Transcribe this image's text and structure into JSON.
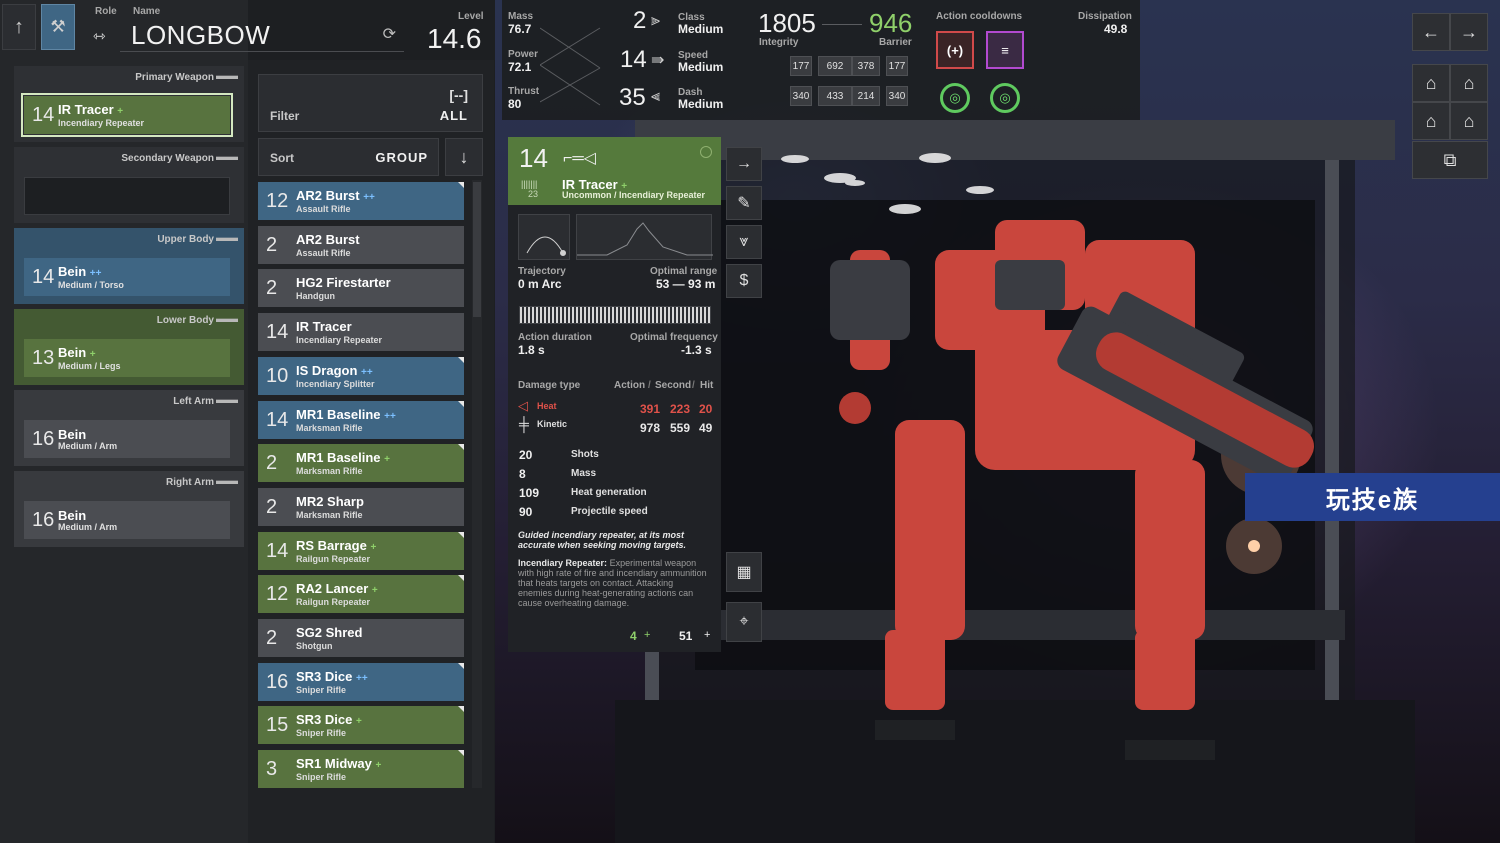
{
  "header": {
    "role_label": "Role",
    "name_label": "Name",
    "name": "LONGBOW",
    "level_label": "Level",
    "level": "14.6"
  },
  "slots": [
    {
      "title": "Primary Weapon",
      "level": "14",
      "name": "IR Tracer",
      "plus": "+",
      "sub": "Incendiary Repeater",
      "color": "green"
    },
    {
      "title": "Secondary Weapon",
      "level": "",
      "name": "",
      "plus": "",
      "sub": "",
      "color": "empty"
    },
    {
      "title": "Upper Body",
      "level": "14",
      "name": "Bein",
      "plus": "++",
      "sub": "Medium / Torso",
      "color": "blue"
    },
    {
      "title": "Lower Body",
      "level": "13",
      "name": "Bein",
      "plus": "+",
      "sub": "Medium / Legs",
      "color": "green"
    },
    {
      "title": "Left Arm",
      "level": "16",
      "name": "Bein",
      "plus": "",
      "sub": "Medium / Arm",
      "color": "grey"
    },
    {
      "title": "Right Arm",
      "level": "16",
      "name": "Bein",
      "plus": "",
      "sub": "Medium / Arm",
      "color": "grey"
    }
  ],
  "filter": {
    "label": "Filter",
    "value": "ALL",
    "icon": "bracket-icon"
  },
  "sort": {
    "label": "Sort",
    "value": "GROUP"
  },
  "items": [
    {
      "level": "12",
      "name": "AR2 Burst",
      "plus": "++",
      "sub": "Assault Rifle",
      "color": "blue"
    },
    {
      "level": "2",
      "name": "AR2 Burst",
      "plus": "",
      "sub": "Assault Rifle",
      "color": "grey"
    },
    {
      "level": "2",
      "name": "HG2 Firestarter",
      "plus": "",
      "sub": "Handgun",
      "color": "grey"
    },
    {
      "level": "14",
      "name": "IR Tracer",
      "plus": "",
      "sub": "Incendiary Repeater",
      "color": "grey"
    },
    {
      "level": "10",
      "name": "IS Dragon",
      "plus": "++",
      "sub": "Incendiary Splitter",
      "color": "blue"
    },
    {
      "level": "14",
      "name": "MR1 Baseline",
      "plus": "++",
      "sub": "Marksman Rifle",
      "color": "blue"
    },
    {
      "level": "2",
      "name": "MR1 Baseline",
      "plus": "+",
      "sub": "Marksman Rifle",
      "color": "green"
    },
    {
      "level": "2",
      "name": "MR2 Sharp",
      "plus": "",
      "sub": "Marksman Rifle",
      "color": "grey"
    },
    {
      "level": "14",
      "name": "RS Barrage",
      "plus": "+",
      "sub": "Railgun Repeater",
      "color": "green"
    },
    {
      "level": "12",
      "name": "RA2 Lancer",
      "plus": "+",
      "sub": "Railgun Repeater",
      "color": "green"
    },
    {
      "level": "2",
      "name": "SG2 Shred",
      "plus": "",
      "sub": "Shotgun",
      "color": "grey"
    },
    {
      "level": "16",
      "name": "SR3 Dice",
      "plus": "++",
      "sub": "Sniper Rifle",
      "color": "blue"
    },
    {
      "level": "15",
      "name": "SR3 Dice",
      "plus": "+",
      "sub": "Sniper Rifle",
      "color": "green"
    },
    {
      "level": "3",
      "name": "SR1 Midway",
      "plus": "+",
      "sub": "Sniper Rifle",
      "color": "green"
    }
  ],
  "stats": {
    "mass_label": "Mass",
    "mass": "76.7",
    "power_label": "Power",
    "power": "72.1",
    "thrust_label": "Thrust",
    "thrust": "80",
    "class_num": "2",
    "class_label": "Class",
    "class_val": "Medium",
    "speed_num": "14",
    "speed_label": "Speed",
    "speed_val": "Medium",
    "dash_num": "35",
    "dash_label": "Dash",
    "dash_val": "Medium",
    "integrity": "1805",
    "integrity_label": "Integrity",
    "barrier": "946",
    "barrier_label": "Barrier",
    "grid_top": [
      "177",
      "692",
      "378",
      "177"
    ],
    "grid_bottom": [
      "340",
      "433",
      "214",
      "340"
    ],
    "cooldowns_label": "Action cooldowns",
    "dissipation_label": "Dissipation",
    "dissipation": "49.8"
  },
  "detail": {
    "level": "14",
    "level_sub": "23",
    "name": "IR Tracer",
    "plus": "+",
    "rarity": "Uncommon / Incendiary Repeater",
    "trajectory_label": "Trajectory",
    "trajectory": "0 m Arc",
    "optimal_range_label": "Optimal range",
    "optimal_range": "53 — 93 m",
    "action_duration_label": "Action duration",
    "action_duration": "1.8 s",
    "optimal_freq_label": "Optimal frequency",
    "optimal_freq": "-1.3 s",
    "damage_type_label": "Damage type",
    "action_label": "Action",
    "second_label": "Second",
    "hit_label": "Hit",
    "heat_label": "Heat",
    "heat_vals": [
      "391",
      "223",
      "20"
    ],
    "kinetic_label": "Kinetic",
    "kinetic_vals": [
      "978",
      "559",
      "49"
    ],
    "rows": [
      {
        "val": "20",
        "label": "Shots"
      },
      {
        "val": "8",
        "label": "Mass"
      },
      {
        "val": "109",
        "label": "Heat generation"
      },
      {
        "val": "90",
        "label": "Projectile speed"
      }
    ],
    "tagline": "Guided incendiary repeater, at its most accurate when seeking moving targets.",
    "desc_title": "Incendiary Repeater:",
    "desc": "Experimental weapon with high rate of fire and incendiary ammunition that heats targets on contact. Attacking enemies during heat-generating actions can cause overheating damage.",
    "footer_left": "4",
    "footer_left_plus": "+",
    "footer_right": "51",
    "footer_right_plus": "+"
  },
  "watermark": "玩技e族",
  "colors": {
    "green": "#58733f",
    "blue": "#3f6684",
    "grey": "#4b4d52",
    "heat": "#e0524a"
  }
}
